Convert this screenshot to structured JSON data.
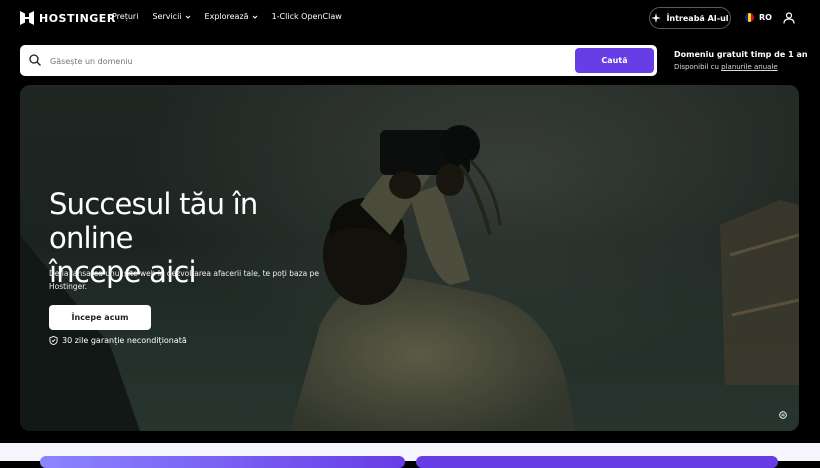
{
  "nav": {
    "logo_text": "HOSTINGER",
    "links": [
      {
        "label": "Prețuri",
        "has_dropdown": false
      },
      {
        "label": "Servicii",
        "has_dropdown": true
      },
      {
        "label": "Explorează",
        "has_dropdown": true
      },
      {
        "label": "1-Click OpenClaw",
        "has_dropdown": false
      }
    ],
    "ai_button": "Întreabă AI-ul",
    "language": "RO"
  },
  "search": {
    "placeholder": "Găsește un domeniu",
    "button": "Caută"
  },
  "promo": {
    "title": "Domeniu gratuit timp de 1 an",
    "sub_prefix": "Disponibil cu",
    "sub_link": "planurile anuale"
  },
  "hero": {
    "title_line1": "Succesul tău în online",
    "title_line2": "începe aici",
    "description": "De la lansarea unui site web la dezvoltarea afacerii tale, te poți baza pe Hostinger.",
    "cta": "Începe acum",
    "guarantee": "30 zile garanție necondiționată"
  },
  "colors": {
    "accent": "#673de6",
    "background": "#000000",
    "bottom_band": "#f4f5ff"
  },
  "icons": [
    "hostinger-logo-icon",
    "chevron-down-icon",
    "ai-sparkle-icon",
    "romania-flag-icon",
    "user-icon",
    "search-icon",
    "shield-check-icon",
    "video-control-icon"
  ]
}
